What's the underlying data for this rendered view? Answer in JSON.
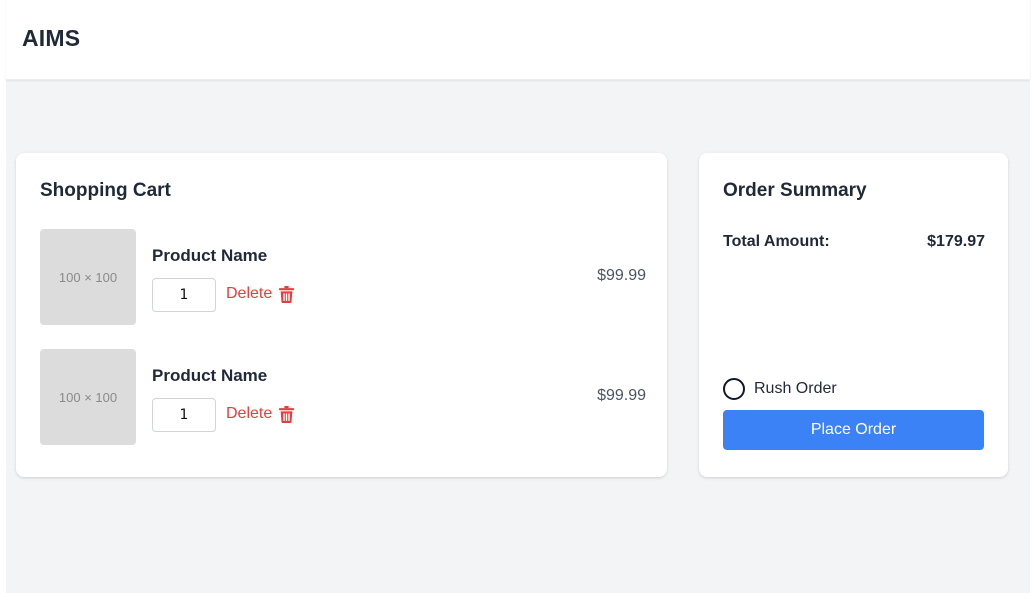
{
  "header": {
    "brand": "AIMS"
  },
  "cart": {
    "title": "Shopping Cart",
    "items": [
      {
        "thumb_label": "100 × 100",
        "name": "Product Name",
        "quantity": "1",
        "delete_label": "Delete",
        "price": "$99.99"
      },
      {
        "thumb_label": "100 × 100",
        "name": "Product Name",
        "quantity": "1",
        "delete_label": "Delete",
        "price": "$99.99"
      }
    ]
  },
  "summary": {
    "title": "Order Summary",
    "total_label": "Total Amount:",
    "total_value": "$179.97",
    "rush_label": "Rush Order",
    "rush_checked": false,
    "place_order_label": "Place Order"
  },
  "colors": {
    "accent": "#3b82f6",
    "delete": "#e53e3e",
    "background": "#f3f4f6"
  },
  "icons": {
    "delete": "trash-icon"
  }
}
